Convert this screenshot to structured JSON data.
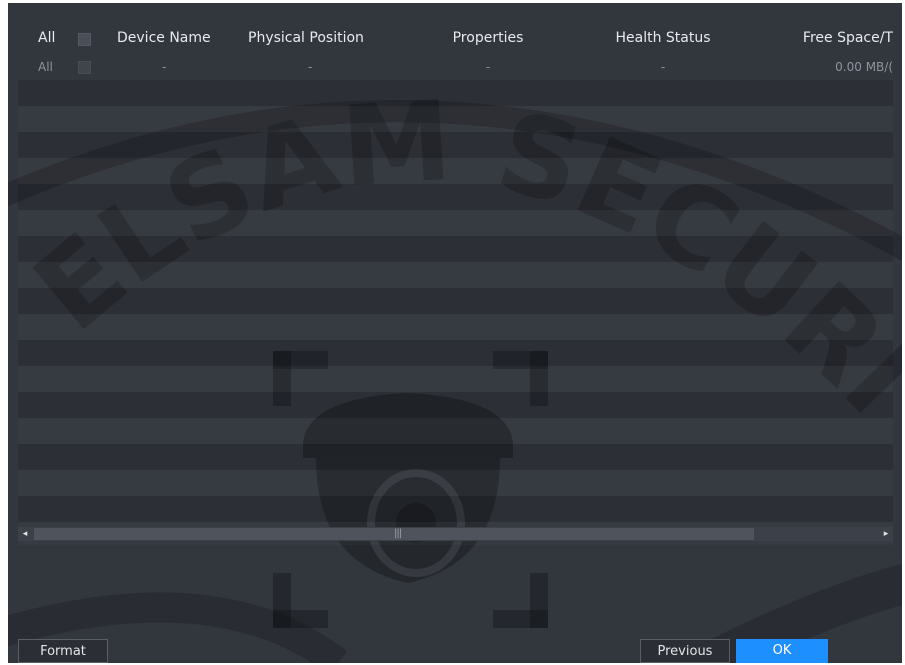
{
  "table": {
    "headers": {
      "all": "All",
      "device_name": "Device Name",
      "physical_position": "Physical Position",
      "properties": "Properties",
      "health_status": "Health Status",
      "free_space": "Free Space/T"
    },
    "rows": [
      {
        "all": "All",
        "device_name": "-",
        "physical_position": "-",
        "properties": "-",
        "health_status": "-",
        "free_space": "0.00 MB/("
      }
    ]
  },
  "scrollbar": {
    "left_arrow": "◂",
    "right_arrow": "▸",
    "grip": "|||"
  },
  "buttons": {
    "format": "Format",
    "previous": "Previous",
    "ok": "OK"
  },
  "watermark": {
    "text": "ELSAM SECURITY"
  },
  "colors": {
    "panel_bg": "#32363d",
    "accent": "#1e8fff",
    "header_text": "#e8eaee",
    "row_text": "#8e949d"
  }
}
